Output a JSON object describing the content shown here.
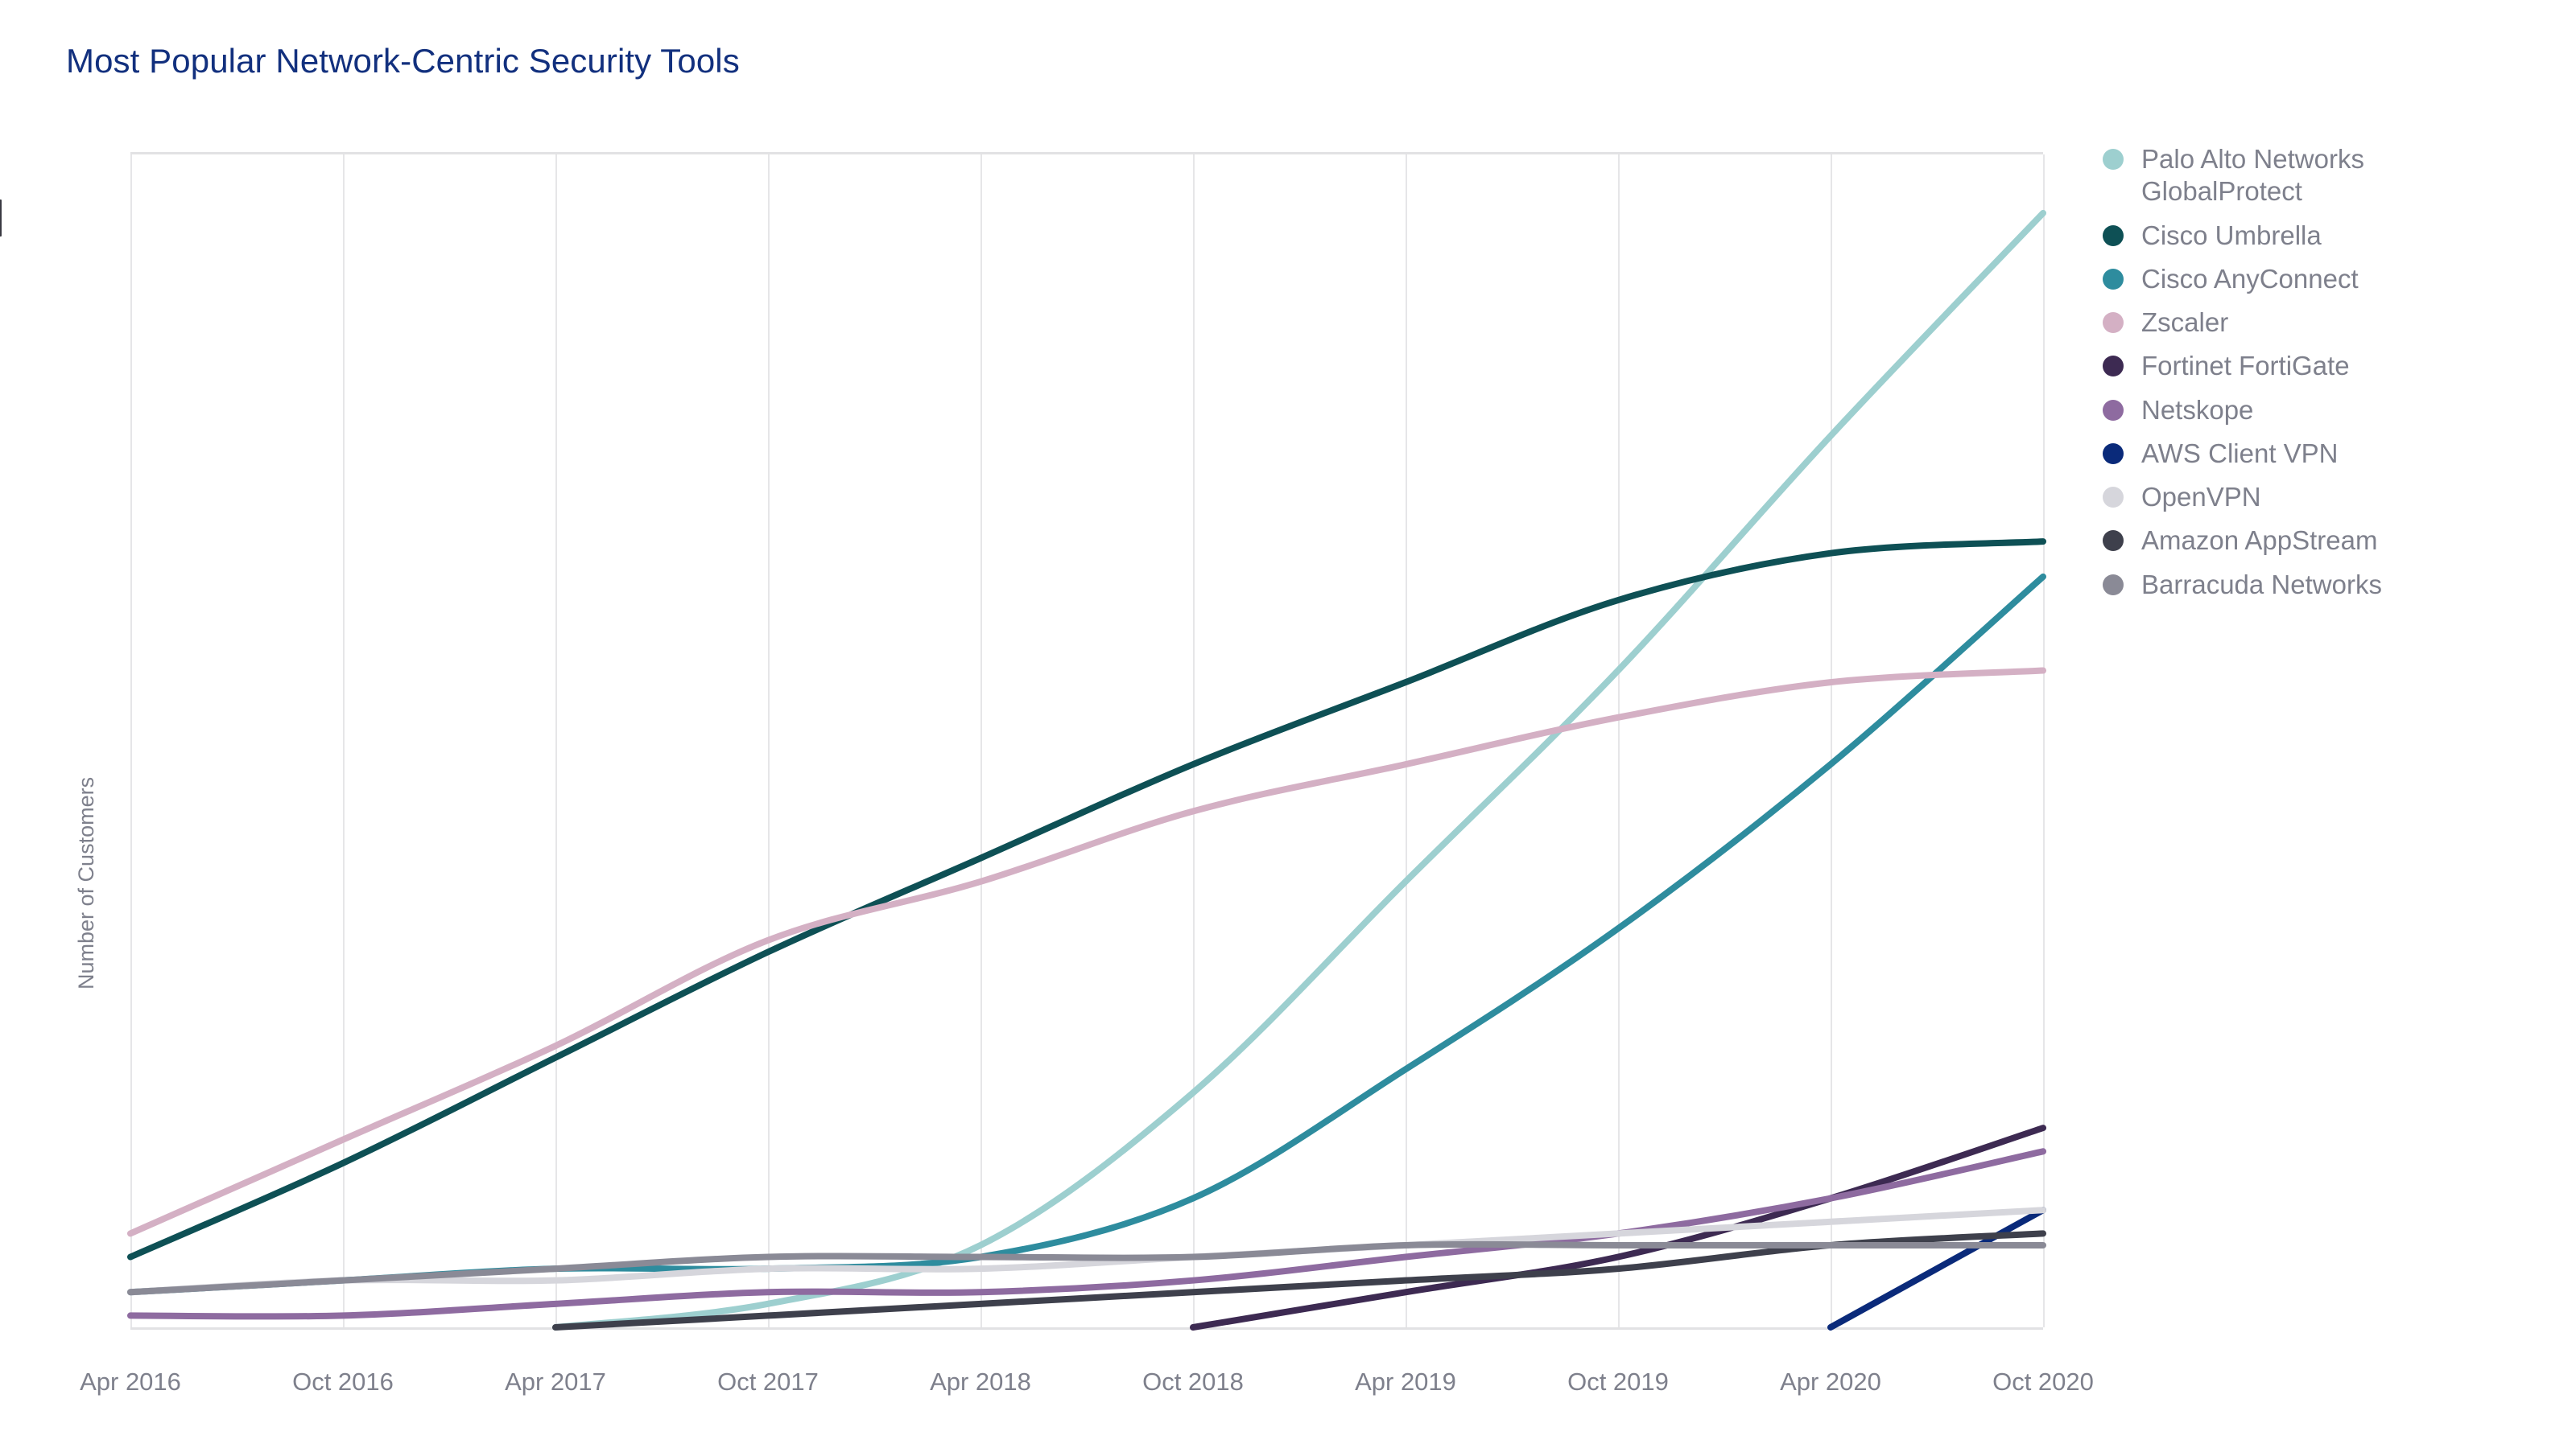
{
  "title": "Most Popular Network-Centric Security Tools",
  "axes": {
    "y_label": "Number of Customers",
    "x_label": ""
  },
  "colors": {
    "title": "#12307E",
    "axis_text": "#7E808C",
    "gridline": "#E6E6E8",
    "plot_border": "#E2E2E4",
    "background": "#FFFFFF"
  },
  "chart_data": {
    "type": "line",
    "title": "Most Popular Network-Centric Security Tools",
    "xlabel": "",
    "ylabel": "Number of Customers",
    "grid": true,
    "legend_position": "right",
    "x": [
      "Apr 2016",
      "Oct 2016",
      "Apr 2017",
      "Oct 2017",
      "Apr 2018",
      "Oct 2018",
      "Apr 2019",
      "Oct 2019",
      "Apr 2020",
      "Oct 2020"
    ],
    "x_tick_labels": [
      "Apr 2016",
      "Oct 2016",
      "Apr 2017",
      "Oct 2017",
      "Apr 2018",
      "Oct 2018",
      "Apr 2019",
      "Oct 2019",
      "Apr 2020",
      "Oct 2020"
    ],
    "ylim": [
      0,
      100
    ],
    "y_tick_labels": [],
    "series": [
      {
        "name": "Palo Alto Networks GlobalProtect",
        "color": "#9DCFCF",
        "start_index": 2,
        "values": [
          null,
          null,
          0,
          2,
          7,
          20,
          38,
          56,
          76,
          95
        ]
      },
      {
        "name": "Cisco Umbrella",
        "color": "#0E5055",
        "start_index": 0,
        "values": [
          6,
          14,
          23,
          32,
          40,
          48,
          55,
          62,
          66,
          67
        ]
      },
      {
        "name": "Cisco AnyConnect",
        "color": "#2E8C9E",
        "start_index": 0,
        "values": [
          3,
          4,
          5,
          5,
          6,
          11,
          22,
          34,
          48,
          64
        ]
      },
      {
        "name": "Zscaler",
        "color": "#D4B0C4",
        "start_index": 0,
        "values": [
          8,
          16,
          24,
          33,
          38,
          44,
          48,
          52,
          55,
          56
        ]
      },
      {
        "name": "Fortinet FortiGate",
        "color": "#3D2A52",
        "start_index": 5,
        "values": [
          null,
          null,
          null,
          null,
          null,
          0,
          3,
          6,
          11,
          17
        ]
      },
      {
        "name": "Netskope",
        "color": "#8E6BA0",
        "start_index": 0,
        "values": [
          1,
          1,
          2,
          3,
          3,
          4,
          6,
          8,
          11,
          15
        ]
      },
      {
        "name": "AWS Client VPN",
        "color": "#0A2A7A",
        "start_index": 8,
        "values": [
          null,
          null,
          null,
          null,
          null,
          null,
          null,
          null,
          0,
          10
        ]
      },
      {
        "name": "OpenVPN",
        "color": "#D6D6DC",
        "start_index": 0,
        "values": [
          3,
          4,
          4,
          5,
          5,
          6,
          7,
          8,
          9,
          10
        ]
      },
      {
        "name": "Amazon AppStream",
        "color": "#3E404C",
        "start_index": 2,
        "values": [
          null,
          null,
          0,
          1,
          2,
          3,
          4,
          5,
          7,
          8
        ]
      },
      {
        "name": "Barracuda Networks",
        "color": "#8A8A96",
        "start_index": 0,
        "values": [
          3,
          4,
          5,
          6,
          6,
          6,
          7,
          7,
          7,
          7
        ]
      }
    ]
  },
  "legend": {
    "items": [
      {
        "label": "Palo Alto Networks GlobalProtect",
        "color": "#9DCFCF"
      },
      {
        "label": "Cisco Umbrella",
        "color": "#0E5055"
      },
      {
        "label": "Cisco AnyConnect",
        "color": "#2E8C9E"
      },
      {
        "label": "Zscaler",
        "color": "#D4B0C4"
      },
      {
        "label": "Fortinet FortiGate",
        "color": "#3D2A52"
      },
      {
        "label": "Netskope",
        "color": "#8E6BA0"
      },
      {
        "label": "AWS Client VPN",
        "color": "#0A2A7A"
      },
      {
        "label": "OpenVPN",
        "color": "#D6D6DC"
      },
      {
        "label": "Amazon AppStream",
        "color": "#3E404C"
      },
      {
        "label": "Barracuda Networks",
        "color": "#8A8A96"
      }
    ]
  }
}
